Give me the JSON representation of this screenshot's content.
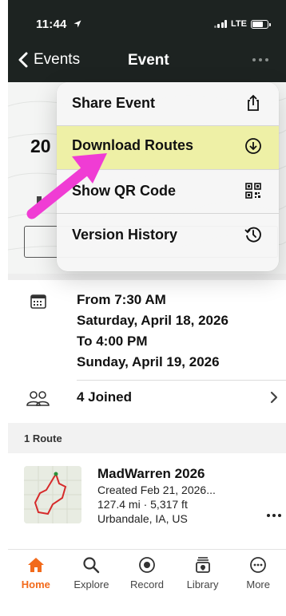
{
  "status_bar": {
    "time": "11:44",
    "network": "LTE"
  },
  "nav": {
    "back_label": "Events",
    "title": "Event"
  },
  "background": {
    "year_partial": "20"
  },
  "event": {
    "when_lines": [
      "From 7:30 AM",
      "Saturday, April 18, 2026",
      "To 4:00 PM",
      "Sunday, April 19, 2026"
    ],
    "joined_label": "4 Joined"
  },
  "routes": {
    "header": "1 Route",
    "items": [
      {
        "title": "MadWarren 2026",
        "created": "Created Feb 21, 2026...",
        "stats": "127.4 mi · 5,317 ft",
        "location": "Urbandale, IA, US"
      }
    ]
  },
  "menu": {
    "items": [
      {
        "label": "Share Event",
        "icon": "share-icon"
      },
      {
        "label": "Download Routes",
        "icon": "download-icon",
        "highlighted": true
      },
      {
        "label": "Show QR Code",
        "icon": "qr-code-icon"
      },
      {
        "label": "Version History",
        "icon": "history-icon"
      }
    ]
  },
  "tabbar": {
    "items": [
      {
        "label": "Home",
        "icon": "home-icon",
        "active": true
      },
      {
        "label": "Explore",
        "icon": "search-icon"
      },
      {
        "label": "Record",
        "icon": "record-icon"
      },
      {
        "label": "Library",
        "icon": "library-icon"
      },
      {
        "label": "More",
        "icon": "more-icon"
      }
    ]
  },
  "colors": {
    "accent": "#f26a1b",
    "topbar": "#1d2321",
    "highlight": "#eef0a6",
    "annotation_arrow": "#f03cd4"
  }
}
